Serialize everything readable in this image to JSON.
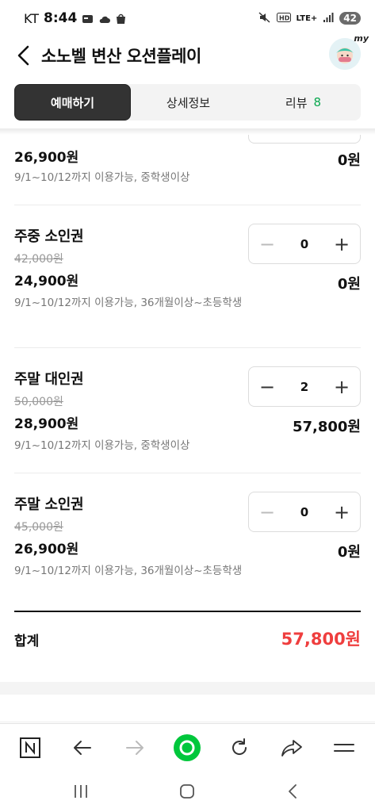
{
  "status_bar": {
    "carrier": "KT",
    "time": "8:44",
    "network": "LTE+",
    "battery": "42"
  },
  "header": {
    "title": "소노벨 변산 오션플레이",
    "avatar_label": "my"
  },
  "tabs": [
    {
      "label": "예매하기",
      "active": true
    },
    {
      "label": "상세정보",
      "active": false
    },
    {
      "label": "리뷰",
      "count": "8",
      "active": false
    }
  ],
  "partial_item": {
    "price": "26,900원",
    "desc": "9/1~10/12까지 이용가능, 중학생이상",
    "subtotal": "0원"
  },
  "items": [
    {
      "name": "주중 소인권",
      "original_price": "42,000원",
      "price": "24,900원",
      "desc": "9/1~10/12까지 이용가능, 36개월이상~초등학생",
      "quantity": "0",
      "subtotal": "0원"
    },
    {
      "name": "주말 대인권",
      "original_price": "50,000원",
      "price": "28,900원",
      "desc": "9/1~10/12까지 이용가능, 중학생이상",
      "quantity": "2",
      "subtotal": "57,800원"
    },
    {
      "name": "주말 소인권",
      "original_price": "45,000원",
      "price": "26,900원",
      "desc": "9/1~10/12까지 이용가능, 36개월이상~초등학생",
      "quantity": "0",
      "subtotal": "0원"
    }
  ],
  "total": {
    "label": "합계",
    "value": "57,800원"
  },
  "browser_toolbar": [
    "naver-n-icon",
    "back-arrow-icon",
    "forward-arrow-icon",
    "home-green-dot-icon",
    "refresh-icon",
    "share-icon",
    "menu-icon"
  ],
  "system_nav": [
    "recents-icon",
    "home-icon",
    "back-icon"
  ],
  "colors": {
    "accent_red": "#ef3e3e",
    "review_green": "#0aa84f",
    "active_tab": "#333333",
    "browser_green": "#00c73c"
  }
}
